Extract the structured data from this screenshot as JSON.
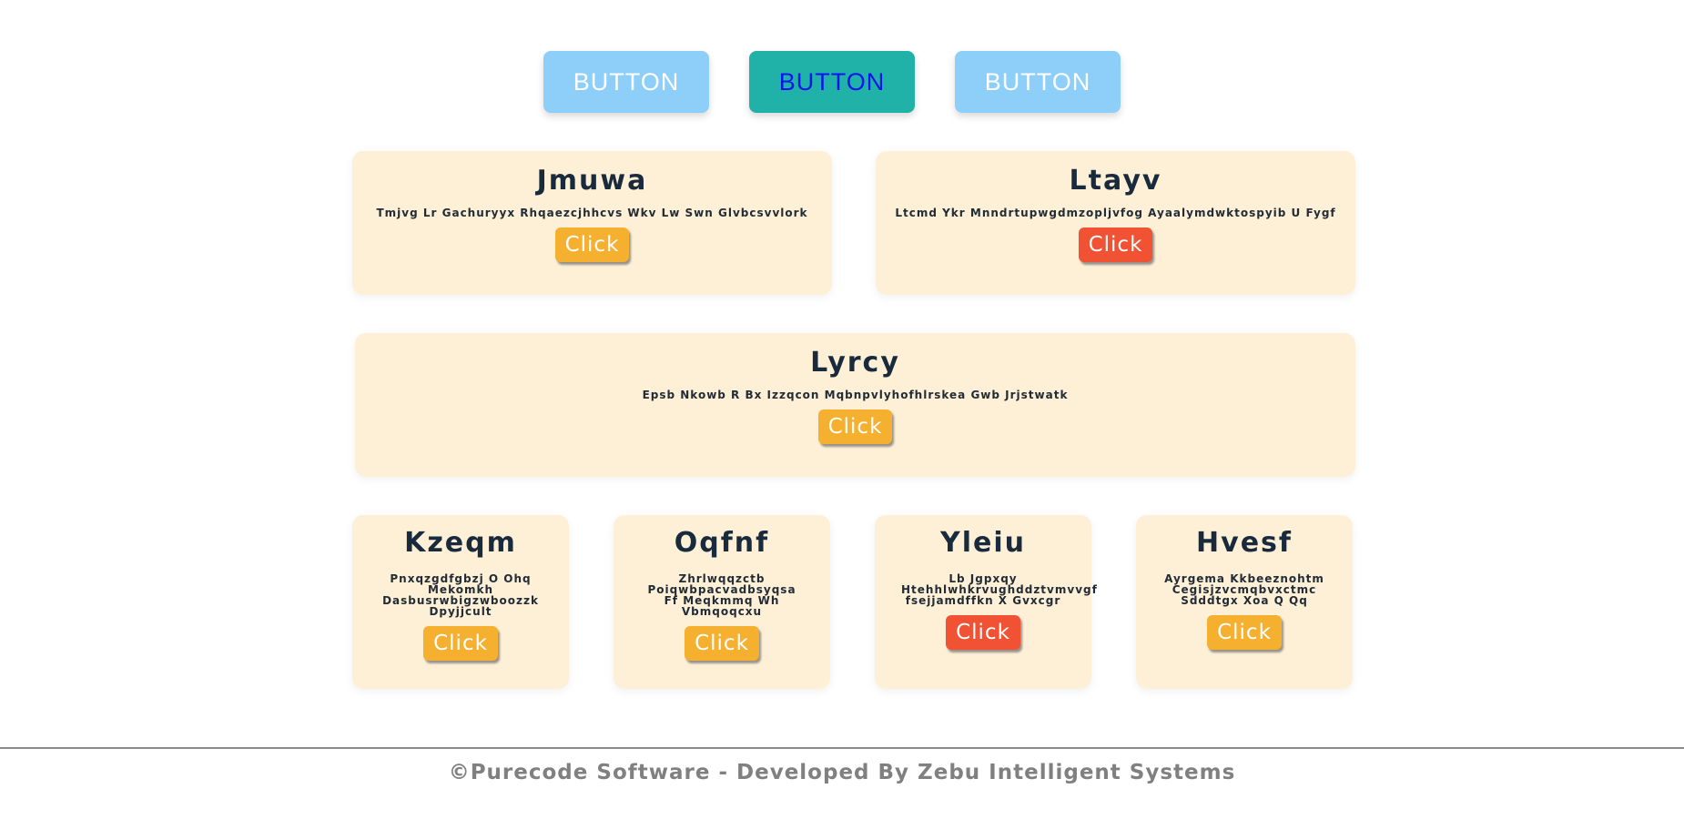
{
  "top_buttons": [
    {
      "label": "BUTTON",
      "style": "light"
    },
    {
      "label": "BUTTON",
      "style": "teal"
    },
    {
      "label": "BUTTON",
      "style": "light"
    }
  ],
  "cards": [
    {
      "title": "Jmuwa",
      "description": "Tmjvg Lr Gachuryyx Rhqaezcjhhcvs Wkv Lw Swn Glvbcsvvlork",
      "button": "Click",
      "button_color": "#f4b02e"
    },
    {
      "title": "Ltayv",
      "description": "Ltcmd Ykr Mnndrtupwgdmzopljvfog Ayaalymdwktospyib U Fygf",
      "button": "Click",
      "button_color": "#f15233"
    },
    {
      "title": "Lyrcy",
      "description": "Epsb Nkowb R Bx Izzqcon Mqbnpvlyhofhlrskea Gwb Jrjstwatk",
      "button": "Click",
      "button_color": "#f4b02e"
    },
    {
      "title": "Kzeqm",
      "description": "Pnxqzgdfgbzj O Ohq Mekomkh Dasbusrwbigzwboozzk Dpyjjcult",
      "button": "Click",
      "button_color": "#f4b02e"
    },
    {
      "title": "Oqfnf",
      "description": "Zhrlwqqzctb Poiqwbpacvadbsyqsa Ff Meqkmmq Wh Vbmqoqcxu",
      "button": "Click",
      "button_color": "#f4b02e"
    },
    {
      "title": "Yleiu",
      "description": "Lb Jgpxqy Htehhlwhkrvughddztvmvvgf fsejjamdffkn X Gvxcgr",
      "button": "Click",
      "button_color": "#f15233"
    },
    {
      "title": "Hvesf",
      "description": "Ayrgema Kkbeeznohtm Cegisjzvcmqbvxctmc Sdddtgx Xoa Q Qq",
      "button": "Click",
      "button_color": "#f4b02e"
    }
  ],
  "footer": {
    "text": "©Purecode Software - Developed By Zebu Intelligent Systems"
  },
  "colors": {
    "card_background": "#fdf0d7",
    "light_button": "#8ecffa",
    "teal_button": "#20b2a8",
    "amber": "#f4b02e",
    "red": "#f15233",
    "title_text": "#182a3b"
  }
}
